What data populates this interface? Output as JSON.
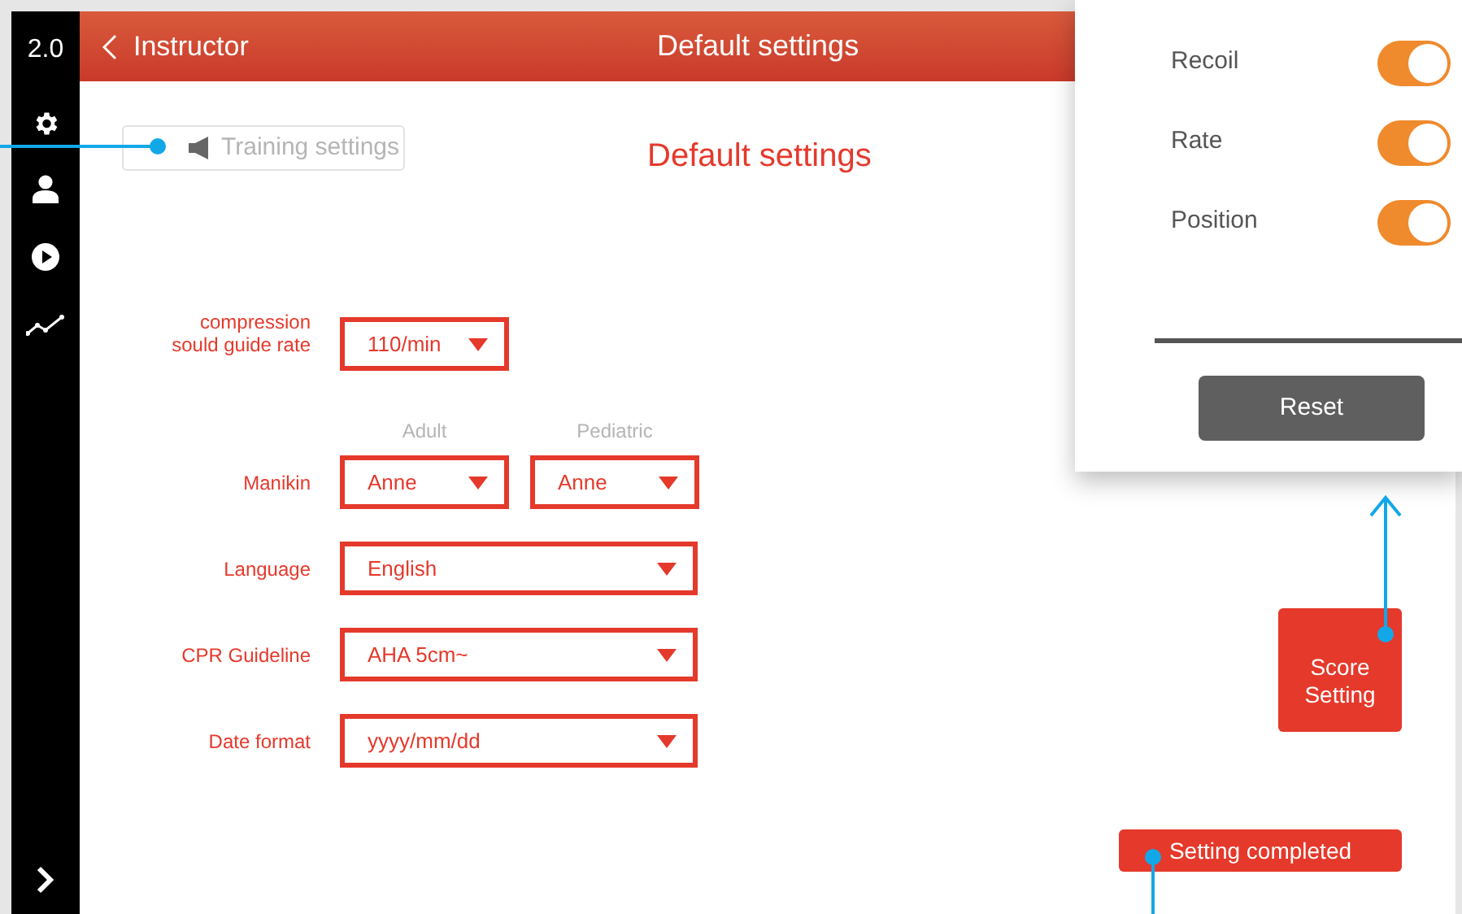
{
  "sidebar": {
    "version": "2.0"
  },
  "header": {
    "back_label": "Instructor",
    "title": "Default settings"
  },
  "training_settings_button": "Training settings",
  "heading": "Default settings",
  "form": [
    {
      "label": "compression\nsould guide rate",
      "fields": [
        {
          "value": "110/min",
          "kind": "short"
        }
      ]
    },
    {
      "label": "Manikin",
      "fields": [
        {
          "caption": "Adult",
          "value": "Anne",
          "kind": "short"
        },
        {
          "caption": "Pediatric",
          "value": "Anne",
          "kind": "short"
        }
      ]
    },
    {
      "label": "Language",
      "fields": [
        {
          "value": "English",
          "kind": "wide"
        }
      ]
    },
    {
      "label": "CPR Guideline",
      "fields": [
        {
          "value": "AHA 5cm~",
          "kind": "wide"
        }
      ]
    },
    {
      "label": "Date format",
      "fields": [
        {
          "value": "yyyy/mm/dd",
          "kind": "wide"
        }
      ]
    }
  ],
  "score_panel": {
    "toggles": [
      {
        "label": "Recoil",
        "on": true
      },
      {
        "label": "Rate",
        "on": true
      },
      {
        "label": "Position",
        "on": true
      }
    ],
    "reset": "Reset"
  },
  "score_setting_button": "Score\nSetting",
  "setting_completed_button": "Setting completed"
}
